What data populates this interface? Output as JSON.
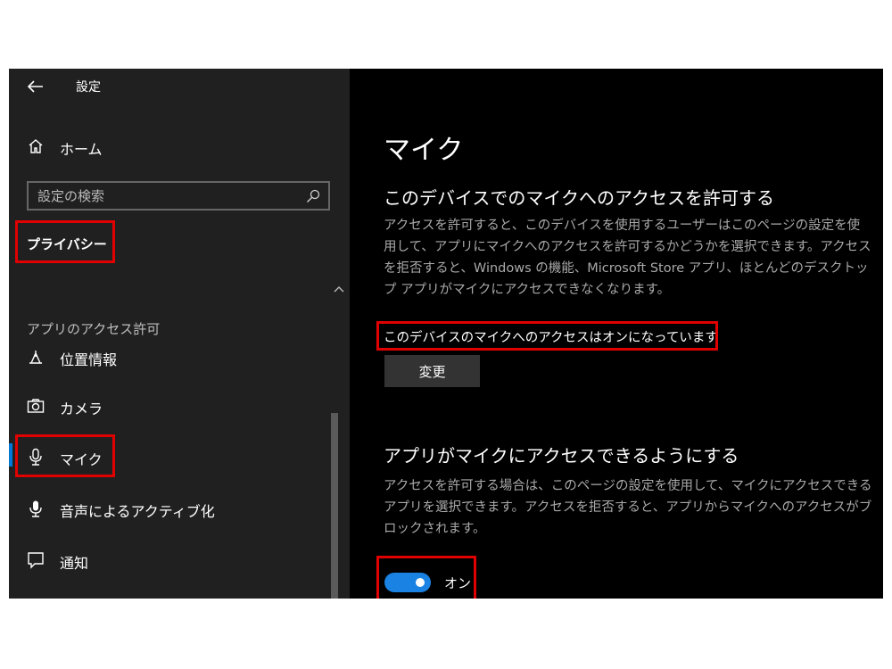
{
  "app": {
    "title": "設定"
  },
  "sidebar": {
    "home_label": "ホーム",
    "search": {
      "placeholder": "設定の検索"
    },
    "category_label": "プライバシー",
    "section_header": "アプリのアクセス許可",
    "items": [
      {
        "label": "位置情報",
        "icon": "location-icon"
      },
      {
        "label": "カメラ",
        "icon": "camera-icon"
      },
      {
        "label": "マイク",
        "icon": "microphone-icon",
        "selected": true
      },
      {
        "label": "音声によるアクティブ化",
        "icon": "voice-activation-icon"
      },
      {
        "label": "通知",
        "icon": "notification-icon"
      }
    ]
  },
  "main": {
    "page_title": "マイク",
    "device_section": {
      "heading": "このデバイスでのマイクへのアクセスを許可する",
      "description": "アクセスを許可すると、このデバイスを使用するユーザーはこのページの設定を使用して、アプリにマイクへのアクセスを許可するかどうかを選択できます。アクセスを拒否すると、Windows の機能、Microsoft Store アプリ、ほとんどのデスクトップ アプリがマイクにアクセスできなくなります。",
      "status": "このデバイスのマイクへのアクセスはオンになっています",
      "change_button": "変更"
    },
    "app_section": {
      "heading": "アプリがマイクにアクセスできるようにする",
      "description": "アクセスを許可する場合は、このページの設定を使用して、マイクにアクセスできるアプリを選択できます。アクセスを拒否すると、アプリからマイクへのアクセスがブロックされます。",
      "toggle_state": "オン",
      "toggle_on": true
    }
  },
  "colors": {
    "accent": "#1a82e2",
    "highlight_box": "#e00000",
    "sidebar_bg": "#202020",
    "main_bg": "#000000"
  }
}
